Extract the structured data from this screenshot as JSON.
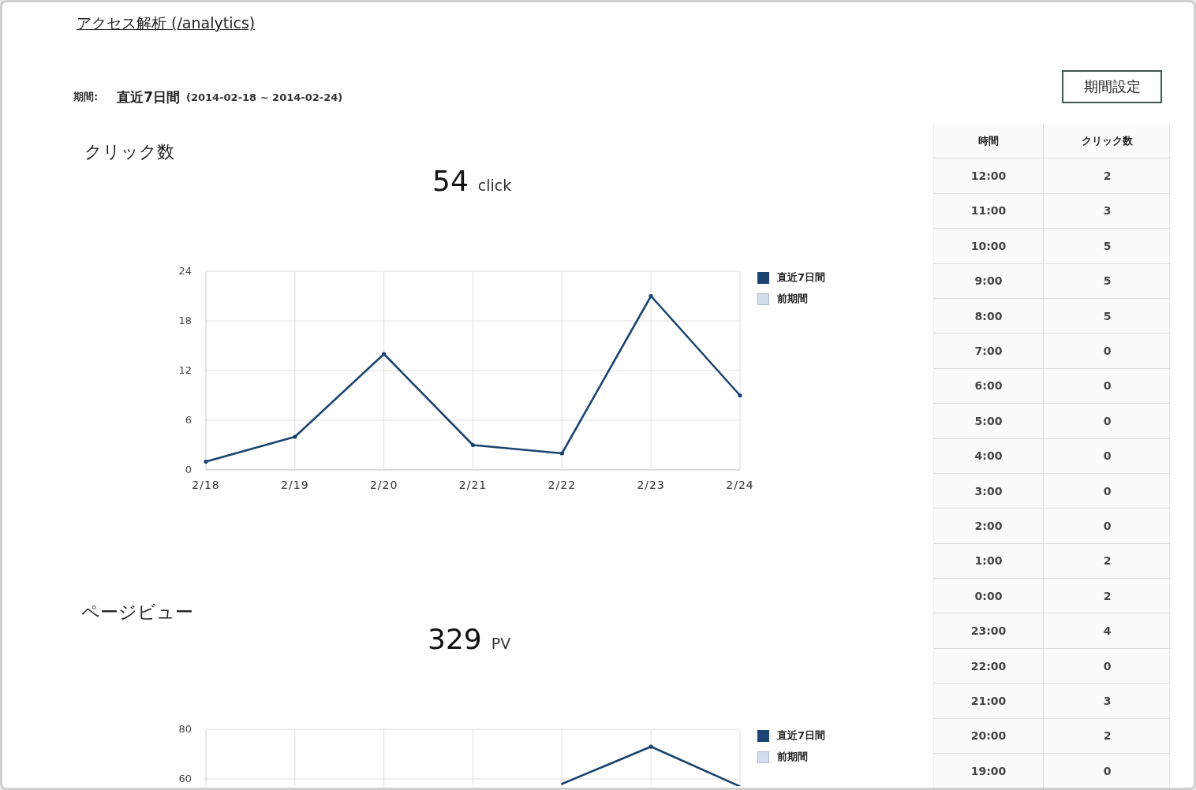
{
  "page": {
    "title": "アクセス解析 (/analytics)"
  },
  "period": {
    "label": "期間:",
    "value": "直近7日間",
    "range": "(2014-02-18 ~ 2014-02-24)"
  },
  "period_button": {
    "label": "期間設定"
  },
  "sections": [
    {
      "heading": "クリック数",
      "total": "54",
      "unit": "click",
      "chart_data": {
        "type": "line",
        "grid": true,
        "categories": [
          "2/18",
          "2/19",
          "2/20",
          "2/21",
          "2/22",
          "2/23",
          "2/24"
        ],
        "ylim": [
          0,
          24
        ],
        "yticks": [
          0,
          6,
          12,
          18,
          24
        ],
        "series": [
          {
            "name": "直近7日間",
            "color": "#1c4470",
            "values": [
              1,
              4,
              14,
              3,
              2,
              21,
              9
            ]
          },
          {
            "name": "前期間",
            "color": "#d5dded",
            "values": [
              null,
              null,
              null,
              null,
              null,
              null,
              null
            ]
          }
        ]
      }
    },
    {
      "heading": "ページビュー",
      "total": "329",
      "unit": "PV",
      "chart_data": {
        "type": "line",
        "grid": true,
        "ylim": [
          57,
          80
        ],
        "yticks": [
          60,
          80
        ],
        "series": [
          {
            "name": "直近7日間",
            "color": "#1c4470",
            "values": [
              null,
              null,
              null,
              null,
              58,
              73,
              57
            ]
          },
          {
            "name": "前期間",
            "color": "#d5dded",
            "values": [
              null,
              null,
              null,
              null,
              null,
              null,
              null
            ]
          }
        ]
      }
    }
  ],
  "hourly_table": {
    "columns": [
      "時間",
      "クリック数"
    ],
    "rows": [
      [
        "12:00",
        "2"
      ],
      [
        "11:00",
        "3"
      ],
      [
        "10:00",
        "5"
      ],
      [
        "9:00",
        "5"
      ],
      [
        "8:00",
        "5"
      ],
      [
        "7:00",
        "0"
      ],
      [
        "6:00",
        "0"
      ],
      [
        "5:00",
        "0"
      ],
      [
        "4:00",
        "0"
      ],
      [
        "3:00",
        "0"
      ],
      [
        "2:00",
        "0"
      ],
      [
        "1:00",
        "2"
      ],
      [
        "0:00",
        "2"
      ],
      [
        "23:00",
        "4"
      ],
      [
        "22:00",
        "0"
      ],
      [
        "21:00",
        "3"
      ],
      [
        "20:00",
        "2"
      ],
      [
        "19:00",
        "0"
      ]
    ]
  }
}
